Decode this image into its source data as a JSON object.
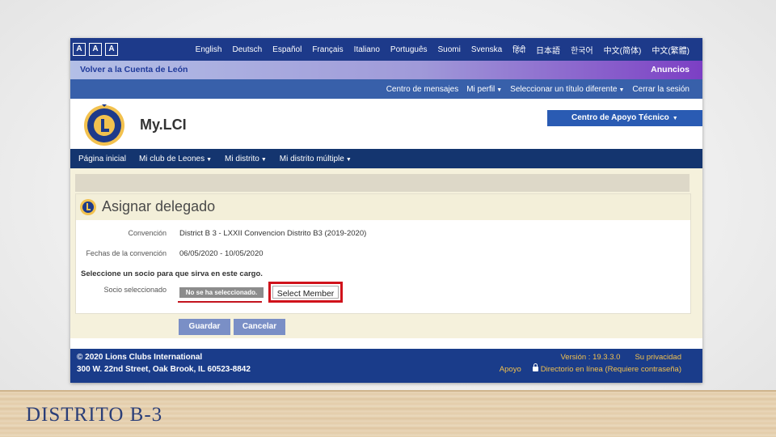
{
  "slide": {
    "caption": "DISTRITO B-3"
  },
  "font_size_buttons": [
    "A",
    "A",
    "A"
  ],
  "languages": [
    "English",
    "Deutsch",
    "Español",
    "Français",
    "Italiano",
    "Português",
    "Suomi",
    "Svenska",
    "हिंदी",
    "日本語",
    "한국어",
    "中文(简体)",
    "中文(繁體)"
  ],
  "backbar": {
    "back_link": "Volver a la Cuenta de León",
    "announcements": "Anuncios"
  },
  "user_menu": {
    "messages": "Centro de mensajes",
    "profile": "Mi perfil",
    "select_title": "Seleccionar un título diferente",
    "logout": "Cerrar la sesión"
  },
  "header": {
    "app_name": "My.LCI",
    "support_center": "Centro de Apoyo Técnico"
  },
  "nav": [
    "Página inicial",
    "Mi club de Leones",
    "Mi distrito",
    "Mi distrito múltiple"
  ],
  "page": {
    "title": "Asignar delegado",
    "convention_label": "Convención",
    "convention_value": "District B 3 - LXXII Convencion Distrito B3 (2019-2020)",
    "dates_label": "Fechas de la convención",
    "dates_value": "06/05/2020 - 10/05/2020",
    "instruction": "Seleccione un socio para que sirva en este cargo.",
    "selected_member_label": "Socio seleccionado",
    "selected_member_value": "No se ha seleccionado.",
    "select_member_button": "Select Member",
    "save_button": "Guardar",
    "cancel_button": "Cancelar"
  },
  "footer": {
    "copyright": "© 2020 Lions Clubs International",
    "address": "300 W. 22nd Street, Oak Brook, IL 60523-8842",
    "version": "Versión : 19.3.3.0",
    "privacy": "Su privacidad",
    "support": "Apoyo",
    "directory": "Directorio en línea (Requiere contraseña)"
  },
  "colors": {
    "brand_blue": "#1d3a8a",
    "nav_dark": "#14356f",
    "highlight_red": "#d0121b",
    "footer_link_gold": "#f2c14e"
  }
}
